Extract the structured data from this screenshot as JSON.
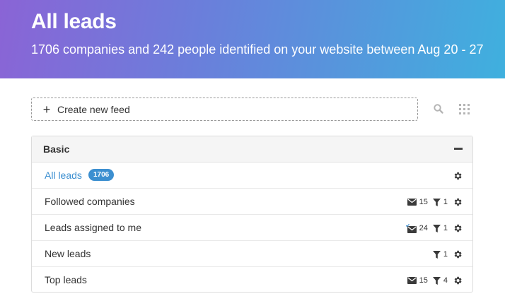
{
  "header": {
    "title": "All leads",
    "subtitle": "1706 companies and 242 people identified on your website between Aug 20 - 27"
  },
  "toolbar": {
    "create_label": "Create new feed",
    "plus_glyph": "+"
  },
  "panel": {
    "title": "Basic",
    "feeds": [
      {
        "name": "All leads",
        "badge": "1706",
        "emails": null,
        "filters": null,
        "active": true
      },
      {
        "name": "Followed companies",
        "emails": "15",
        "filters": "1"
      },
      {
        "name": "Leads assigned to me",
        "emails": "24",
        "filters": "1",
        "email_checked": true
      },
      {
        "name": "New leads",
        "emails": null,
        "filters": "1"
      },
      {
        "name": "Top leads",
        "emails": "15",
        "filters": "4"
      }
    ]
  },
  "colors": {
    "accent": "#3c8fd0",
    "gradient_start": "#8a64d6",
    "gradient_end": "#3fb0de"
  }
}
